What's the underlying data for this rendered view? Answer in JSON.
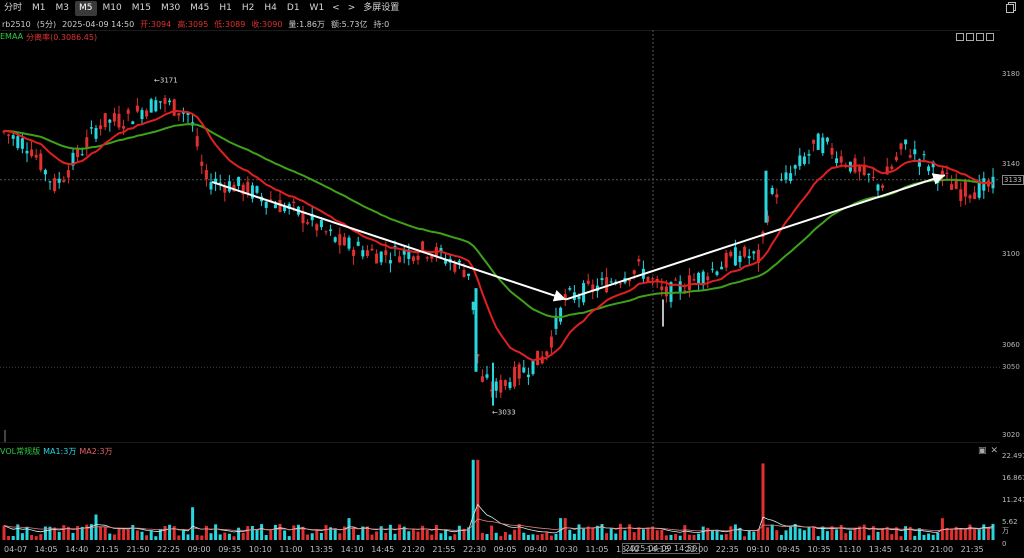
{
  "toolbar": {
    "items": [
      {
        "label": "分时",
        "active": false
      },
      {
        "label": "M1",
        "active": false
      },
      {
        "label": "M3",
        "active": false
      },
      {
        "label": "M5",
        "active": true
      },
      {
        "label": "M10",
        "active": false
      },
      {
        "label": "M15",
        "active": false
      },
      {
        "label": "M30",
        "active": false
      },
      {
        "label": "M45",
        "active": false
      },
      {
        "label": "H1",
        "active": false
      },
      {
        "label": "H2",
        "active": false
      },
      {
        "label": "H4",
        "active": false
      },
      {
        "label": "D1",
        "active": false
      },
      {
        "label": "W1",
        "active": false
      }
    ],
    "prev_icon": "<",
    "next_icon": ">",
    "multi_screen_label": "多屏设置"
  },
  "info": {
    "symbol": "rb2510",
    "period": "(5分)",
    "datetime": "2025-04-09 14:50",
    "open": "开:3094",
    "high": "高:3095",
    "low": "低:3089",
    "close": "收:3090",
    "volume": "量:1.86万",
    "amount": "额:5.73亿",
    "position": "持:0"
  },
  "indicator": {
    "name": "EMAA",
    "detail": "分离率(0.3086.45)",
    "name_color": "#2ecc40",
    "detail_color": "#e03030"
  },
  "price_axis": {
    "labels": [
      "3180",
      "3140",
      "3100",
      "3060",
      "3050",
      "3020"
    ],
    "current": "3133"
  },
  "annotations": {
    "high_label": "←3171",
    "low_label": "←3033"
  },
  "volume": {
    "label": "VOL常规版",
    "ma1": "MA1:3万",
    "ma2": "MA2:3万",
    "axis": [
      "22.497",
      "16.867",
      "11.247",
      "5.62万",
      "0"
    ]
  },
  "time_axis": {
    "labels": [
      "04-07",
      "14:05",
      "14:40",
      "21:15",
      "21:50",
      "22:25",
      "09:00",
      "09:35",
      "10:10",
      "11:00",
      "13:35",
      "14:10",
      "14:45",
      "21:20",
      "21:55",
      "22:30",
      "09:05",
      "09:40",
      "10:30",
      "11:05",
      "13:40",
      "14:15",
      "2025-04-09 14:50",
      "22:00",
      "22:35",
      "09:10",
      "09:45",
      "10:35",
      "11:10",
      "13:45",
      "14:20",
      "21:00",
      "21:35"
    ]
  },
  "colors": {
    "up": "#e03030",
    "down": "#26d7e0",
    "ema_fast": "#e02020",
    "ema_slow": "#3fa01a",
    "background": "#000000"
  },
  "chart_data": {
    "type": "candlestick",
    "ylim": [
      3020,
      3190
    ],
    "price_ticks": [
      3180,
      3140,
      3100,
      3060,
      3050,
      3020
    ],
    "high": 3171,
    "low": 3033,
    "current": 3133,
    "volume_ticks": [
      22.497,
      16.867,
      11.247,
      5.62,
      0
    ]
  }
}
